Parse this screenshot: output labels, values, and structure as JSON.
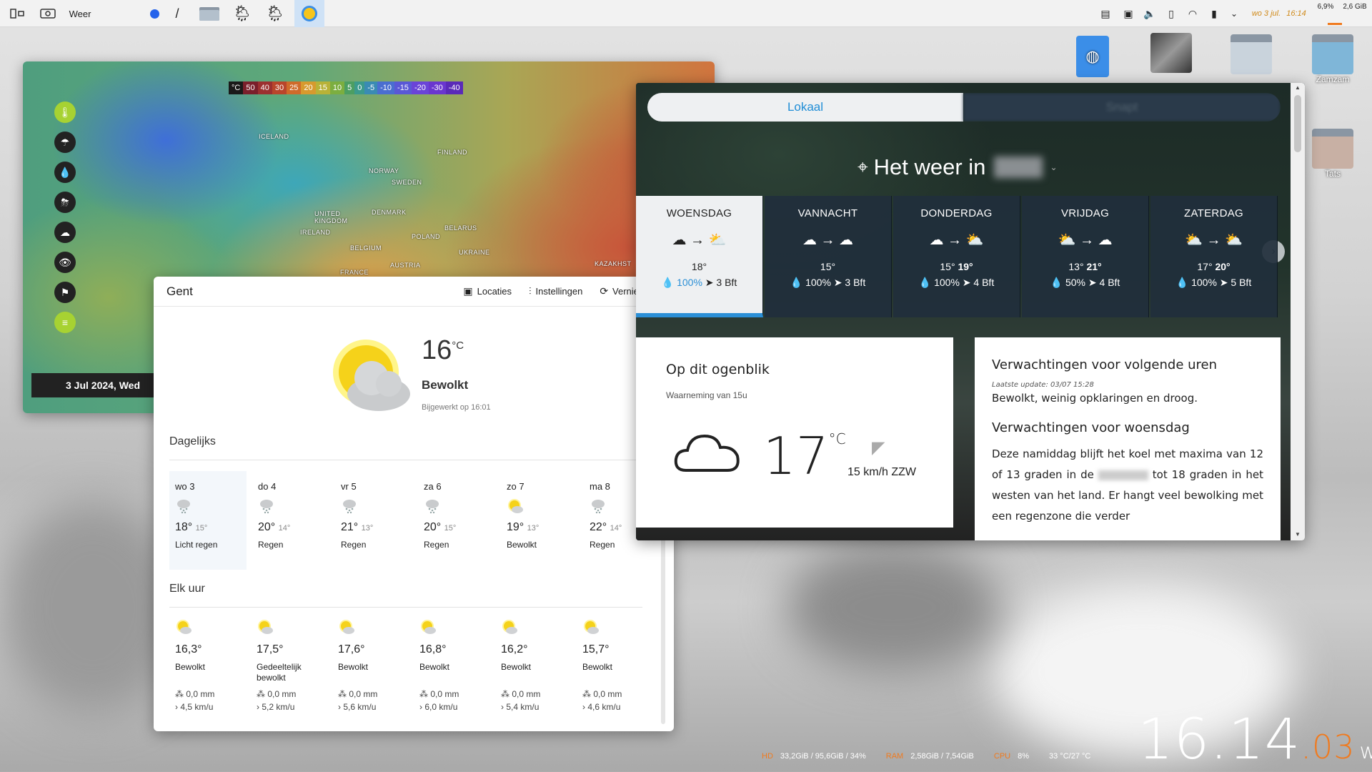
{
  "topbar": {
    "app_label": "Weer",
    "date_text": "wo 3 jul.",
    "time_text": "16:14",
    "cpu_small": "6,9%",
    "mem_small": "2,6 GiB"
  },
  "desktop": {
    "icons": [
      {
        "label": ""
      },
      {
        "label": ""
      },
      {
        "label": ""
      },
      {
        "label": "Zamzam"
      },
      {
        "label": "Tats"
      }
    ]
  },
  "map": {
    "legend": [
      "°C",
      "50",
      "40",
      "30",
      "25",
      "20",
      "15",
      "10",
      "5",
      "0",
      "-5",
      "-10",
      "-15",
      "-20",
      "-30",
      "-40"
    ],
    "legend_colors": [
      "#1a1a1a",
      "#7a1f2b",
      "#9c3030",
      "#b9452b",
      "#cf6b2a",
      "#d79a2e",
      "#b8b237",
      "#7cae40",
      "#4c9e62",
      "#3c9a8c",
      "#3a8bb4",
      "#4a6ed0",
      "#5a58d6",
      "#6a44d8",
      "#6a36cf",
      "#5a2ab8"
    ],
    "countries": [
      "ICELAND",
      "FINLAND",
      "NORWAY",
      "SWEDEN",
      "DENMARK",
      "UNITED KINGDOM",
      "IRELAND",
      "BELARUS",
      "POLAND",
      "BELGIUM",
      "UKRAINE",
      "AUSTRIA",
      "FRANCE",
      "KAZAKHST"
    ],
    "date": "3 Jul 2024, Wed"
  },
  "gent": {
    "city": "Gent",
    "actions": {
      "locations": "Locaties",
      "settings": "Instellingen",
      "refresh": "Vernieuwen"
    },
    "current": {
      "temp": "16",
      "unit": "°C",
      "desc": "Bewolkt",
      "updated": "Bijgewerkt op 16:01"
    },
    "daily_title": "Dagelijks",
    "daily": [
      {
        "day": "wo 3",
        "hi": "18°",
        "lo": "15°",
        "desc": "Licht regen",
        "icon": "rain"
      },
      {
        "day": "do 4",
        "hi": "20°",
        "lo": "14°",
        "desc": "Regen",
        "icon": "rain"
      },
      {
        "day": "vr 5",
        "hi": "21°",
        "lo": "13°",
        "desc": "Regen",
        "icon": "rain"
      },
      {
        "day": "za 6",
        "hi": "20°",
        "lo": "15°",
        "desc": "Regen",
        "icon": "rain"
      },
      {
        "day": "zo 7",
        "hi": "19°",
        "lo": "13°",
        "desc": "Bewolkt",
        "icon": "sun"
      },
      {
        "day": "ma 8",
        "hi": "22°",
        "lo": "14°",
        "desc": "Regen",
        "icon": "rain"
      }
    ],
    "hourly_title": "Elk uur",
    "hourly": [
      {
        "temp": "16,3°",
        "desc": "Bewolkt",
        "rain": "0,0 mm",
        "wind": "4,5 km/u"
      },
      {
        "temp": "17,5°",
        "desc": "Gedeeltelijk bewolkt",
        "rain": "0,0 mm",
        "wind": "5,2 km/u"
      },
      {
        "temp": "17,6°",
        "desc": "Bewolkt",
        "rain": "0,0 mm",
        "wind": "5,6 km/u"
      },
      {
        "temp": "16,8°",
        "desc": "Bewolkt",
        "rain": "0,0 mm",
        "wind": "6,0 km/u"
      },
      {
        "temp": "16,2°",
        "desc": "Bewolkt",
        "rain": "0,0 mm",
        "wind": "5,4 km/u"
      },
      {
        "temp": "15,7°",
        "desc": "Bewolkt",
        "rain": "0,0 mm",
        "wind": "4,6 km/u"
      }
    ]
  },
  "site": {
    "tabs": {
      "active": "Lokaal",
      "other": "Snapt"
    },
    "heading": "Het weer in",
    "days": [
      {
        "name": "WOENSDAG",
        "lo": "18°",
        "hi": "",
        "rain": "100%",
        "wind": "3 Bft"
      },
      {
        "name": "VANNACHT",
        "lo": "15°",
        "hi": "",
        "rain": "100%",
        "wind": "3 Bft"
      },
      {
        "name": "DONDERDAG",
        "lo": "15°",
        "hi": "19°",
        "rain": "100%",
        "wind": "4 Bft"
      },
      {
        "name": "VRIJDAG",
        "lo": "13°",
        "hi": "21°",
        "rain": "50%",
        "wind": "4 Bft"
      },
      {
        "name": "ZATERDAG",
        "lo": "17°",
        "hi": "20°",
        "rain": "100%",
        "wind": "5 Bft"
      }
    ],
    "now": {
      "title": "Op dit ogenblik",
      "sub": "Waarneming van 15u",
      "temp": "17",
      "unit": "°C",
      "wind": "15 km/h ZZW"
    },
    "forecast": {
      "title1": "Verwachtingen voor volgende uren",
      "updated": "Laatste update: 03/07 15:28",
      "text1": "Bewolkt, weinig opklaringen en droog.",
      "title2": "Verwachtingen voor woensdag",
      "text2a": "Deze namiddag blijft het koel met maxima van 12 of 13 graden in de",
      "text2b": "tot 18 graden in het westen van het land. Er hangt veel bewolking met een regenzone die verder"
    }
  },
  "sysbar": {
    "hd_label": "HD",
    "hd_val": "33,2GiB / 95,6GiB / 34%",
    "ram_label": "RAM",
    "ram_val": "2,58GiB / 7,54GiB",
    "cpu_label": "CPU",
    "cpu_val": "8%",
    "temp_val": "33 °C/27 °C"
  },
  "clock": {
    "hm": "16.14",
    "sec": "03",
    "day": "wo"
  }
}
